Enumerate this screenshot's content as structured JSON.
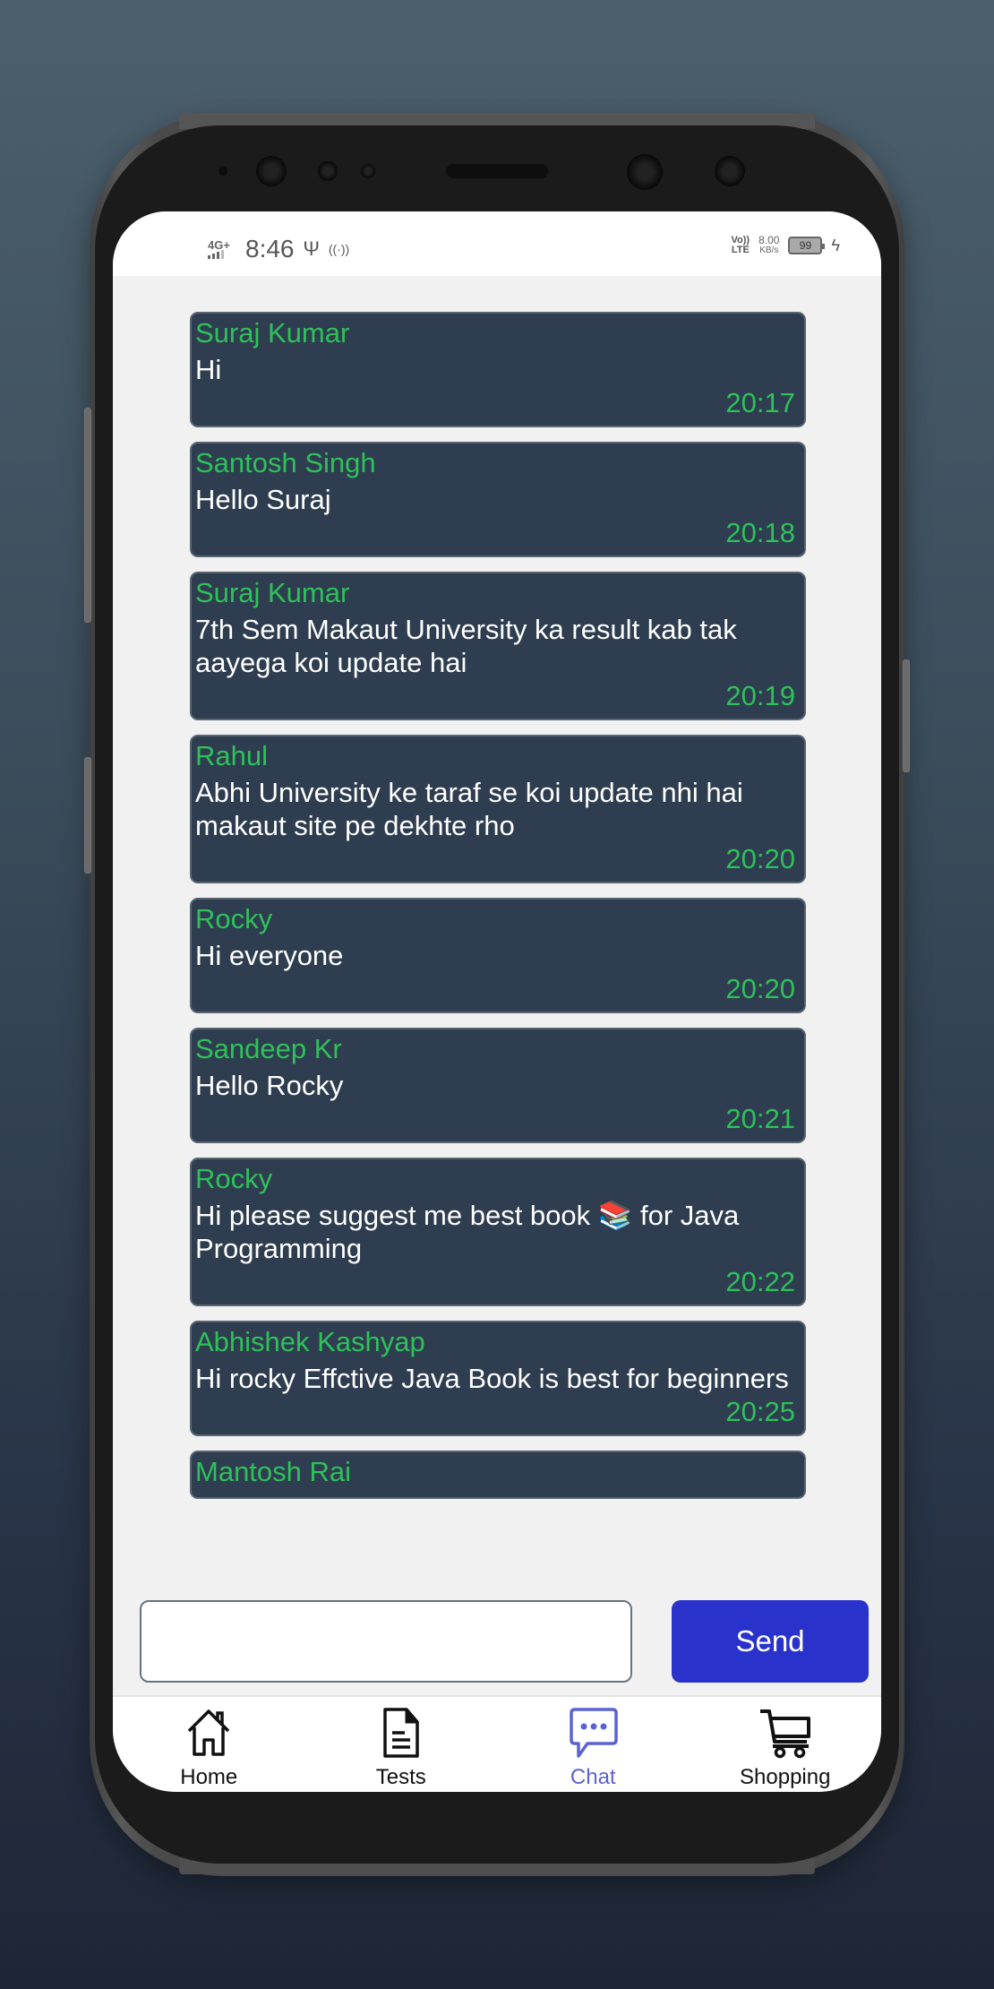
{
  "status_bar": {
    "network": "4G+",
    "time": "8:46",
    "volte": [
      "Vo))",
      "LTE"
    ],
    "speed_value": "8.00",
    "speed_unit": "KB/s",
    "battery": "99"
  },
  "messages": [
    {
      "name": "Suraj Kumar",
      "text": "Hi",
      "time": "20:17"
    },
    {
      "name": "Santosh Singh",
      "text": "Hello Suraj",
      "time": "20:18"
    },
    {
      "name": "Suraj Kumar",
      "text": "7th Sem Makaut University ka result kab tak aayega koi update hai",
      "time": "20:19"
    },
    {
      "name": "Rahul",
      "text": "Abhi University ke taraf se koi update nhi hai makaut site pe dekhte rho",
      "time": "20:20"
    },
    {
      "name": "Rocky",
      "text": "Hi everyone",
      "time": "20:20"
    },
    {
      "name": "Sandeep Kr",
      "text": "Hello Rocky",
      "time": "20:21"
    },
    {
      "name": "Rocky",
      "text": "Hi please suggest me best book 📚 for Java Programming",
      "time": "20:22"
    },
    {
      "name": "Abhishek Kashyap",
      "text": "Hi rocky Effctive Java Book is best for beginners",
      "time": "20:25"
    },
    {
      "name": "Mantosh Rai",
      "text": "",
      "time": ""
    }
  ],
  "composer": {
    "value": "",
    "placeholder": "",
    "send_label": "Send"
  },
  "nav": {
    "items": [
      {
        "label": "Home",
        "icon": "home-icon",
        "active": false
      },
      {
        "label": "Tests",
        "icon": "document-icon",
        "active": false
      },
      {
        "label": "Chat",
        "icon": "chat-bubble-icon",
        "active": true
      },
      {
        "label": "Shopping",
        "icon": "cart-icon",
        "active": false
      }
    ],
    "active_color": "#5b63d3"
  },
  "colors": {
    "bubble_bg": "#2e3d4f",
    "sender_name": "#2ec15a",
    "send_button": "#2a32cc"
  }
}
